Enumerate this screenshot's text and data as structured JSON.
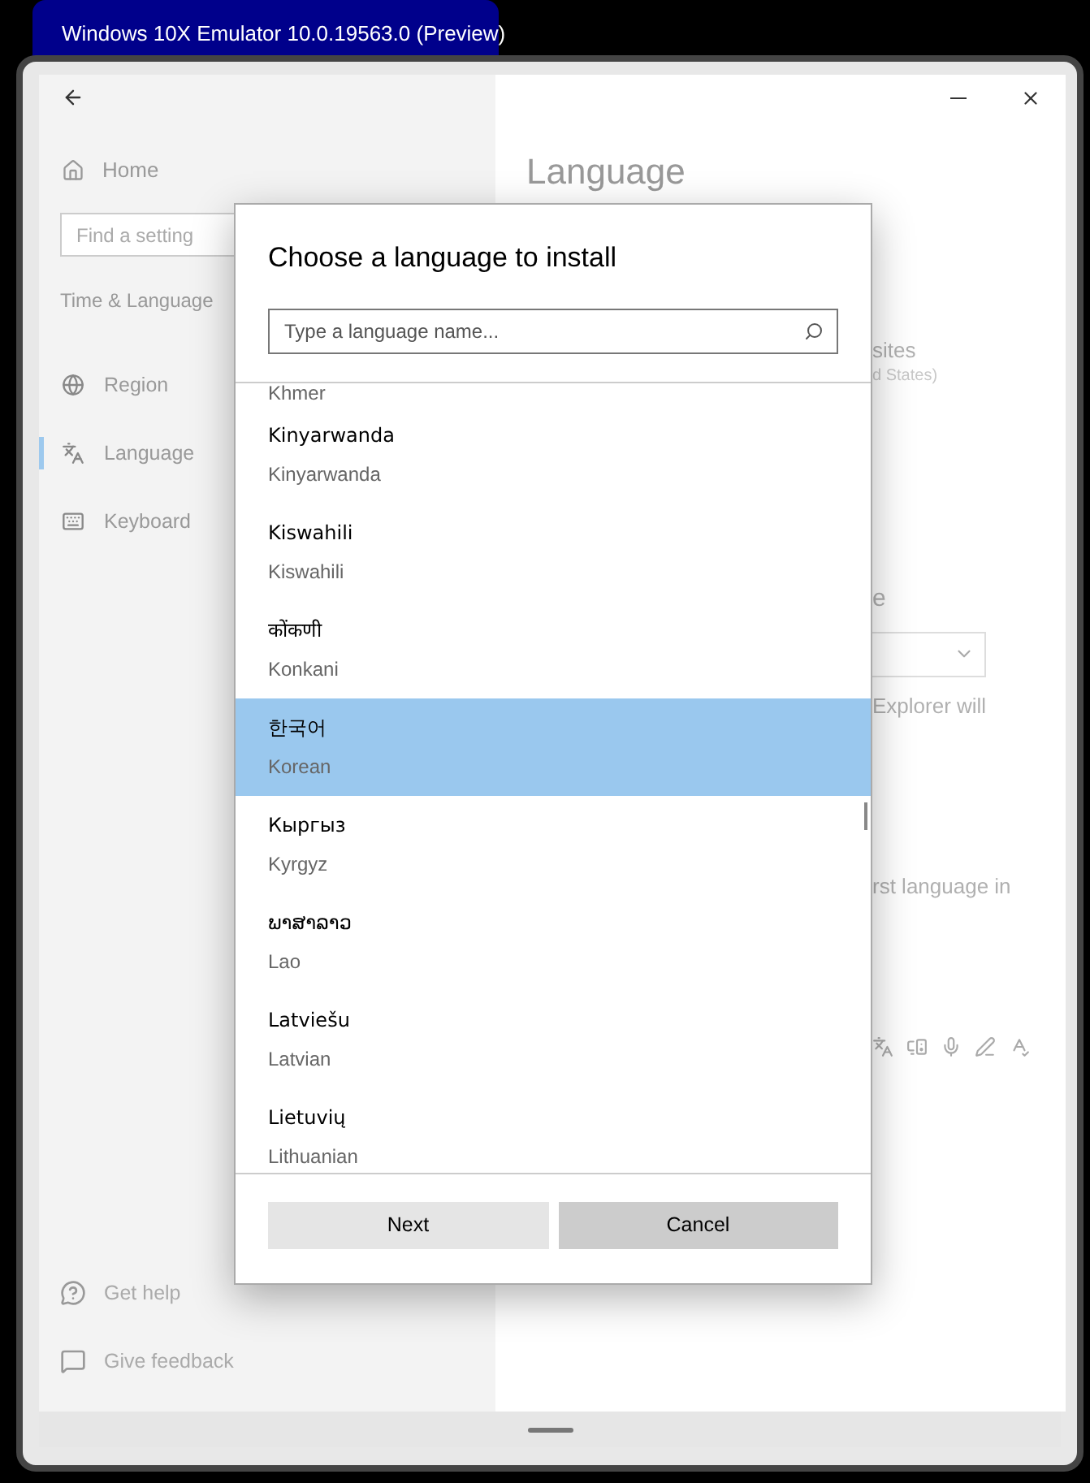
{
  "emulator_tab": {
    "title": "Windows 10X Emulator 10.0.19563.0 (Preview)"
  },
  "sidebar": {
    "home": "Home",
    "search": {
      "placeholder": "Find a setting"
    },
    "section": "Time & Language",
    "items": [
      {
        "label": "Region",
        "kind": "region",
        "selected": false
      },
      {
        "label": "Language",
        "kind": "language",
        "selected": true
      },
      {
        "label": "Keyboard",
        "kind": "keyboard",
        "selected": false
      }
    ],
    "footer": [
      {
        "label": "Get help",
        "kind": "help"
      },
      {
        "label": "Give feedback",
        "kind": "feedback"
      }
    ]
  },
  "page": {
    "title": "Language",
    "fragments": [
      {
        "text": "sites",
        "kind": "text"
      },
      {
        "text": "d States)",
        "kind": "subtext"
      },
      {
        "text": "e",
        "kind": "heading"
      },
      {
        "text": "Explorer will",
        "kind": "text"
      },
      {
        "text": "rst language in",
        "kind": "text"
      }
    ]
  },
  "dialog": {
    "title": "Choose a language to install",
    "search": {
      "placeholder": "Type a language name..."
    },
    "partial_item": "Khmer",
    "languages": [
      {
        "native": "Kinyarwanda",
        "english": "Kinyarwanda",
        "selected": false
      },
      {
        "native": "Kiswahili",
        "english": "Kiswahili",
        "selected": false
      },
      {
        "native": "कोंकणी",
        "english": "Konkani",
        "selected": false
      },
      {
        "native": "한국어",
        "english": "Korean",
        "selected": true
      },
      {
        "native": "Кыргыз",
        "english": "Kyrgyz",
        "selected": false
      },
      {
        "native": "ພາສາລາວ",
        "english": "Lao",
        "selected": false
      },
      {
        "native": "Latviešu",
        "english": "Latvian",
        "selected": false
      },
      {
        "native": "Lietuvių",
        "english": "Lithuanian",
        "selected": false
      }
    ],
    "buttons": [
      {
        "label": "Next",
        "kind": "secondary"
      },
      {
        "label": "Cancel",
        "kind": "primary"
      }
    ]
  }
}
